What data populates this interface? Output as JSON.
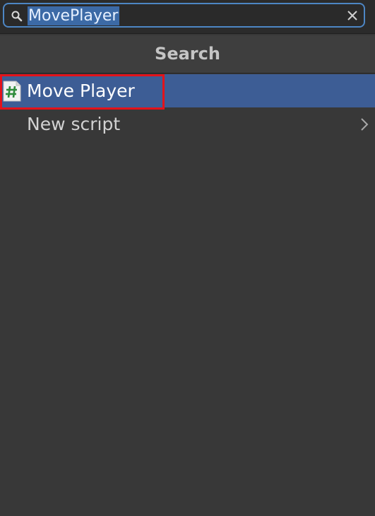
{
  "search": {
    "value": "MovePlayer",
    "icon": "search-icon",
    "clear_icon": "close-icon"
  },
  "header": {
    "title": "Search"
  },
  "results": [
    {
      "label": "Move Player",
      "icon": "csharp-script-icon",
      "selected": true
    },
    {
      "label": "New script",
      "icon": "chevron-right-icon",
      "selected": false
    }
  ],
  "colors": {
    "selection": "#3d5d95",
    "focus_outline": "#4d86c4",
    "annotation_box": "#e3131b",
    "script_icon_hash": "#2e8b3a"
  }
}
